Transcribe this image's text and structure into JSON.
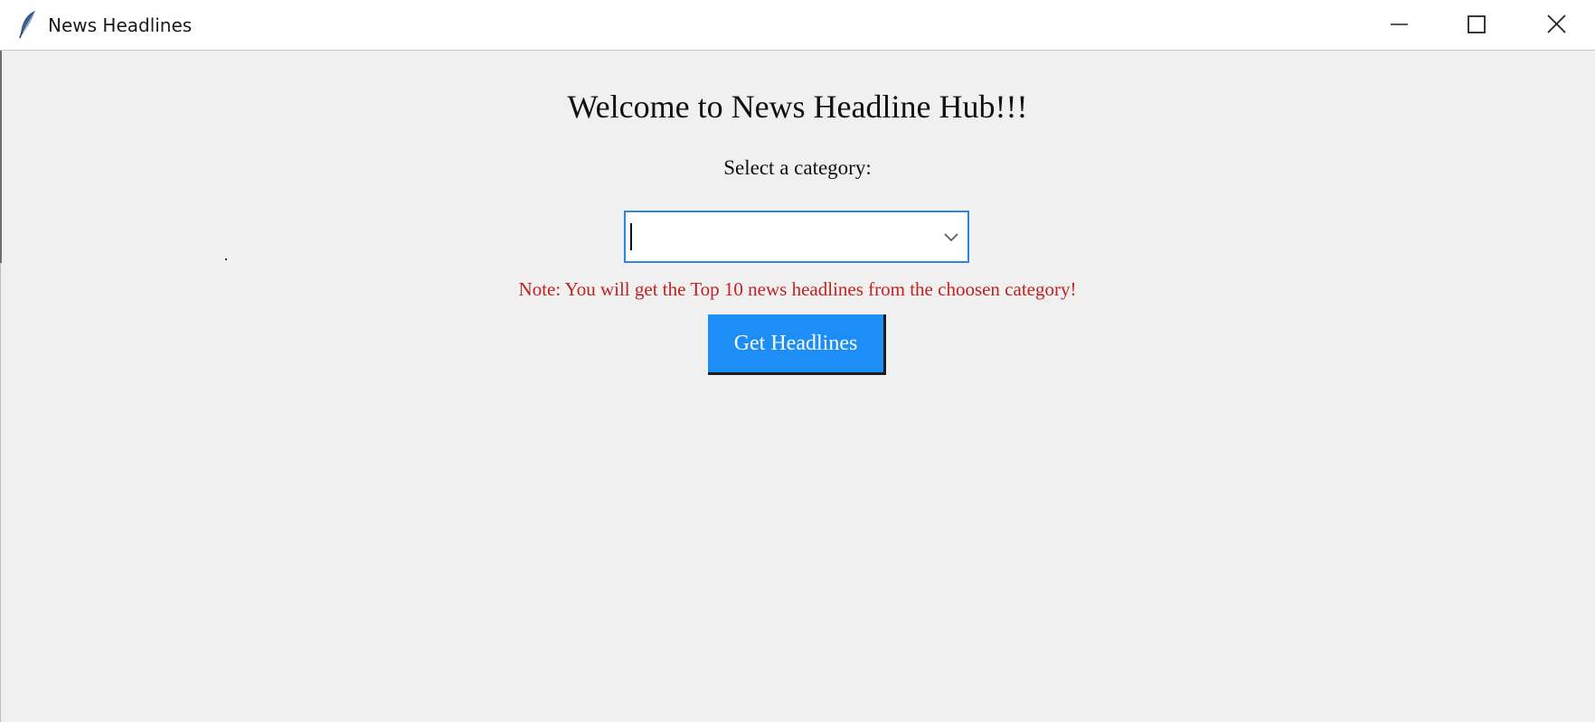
{
  "window": {
    "title": "News Headlines",
    "app_icon": "feather-icon",
    "controls": {
      "minimize_icon": "minimize-icon",
      "maximize_icon": "maximize-icon",
      "close_icon": "close-icon"
    }
  },
  "main": {
    "heading": "Welcome to News Headline Hub!!!",
    "category_label": "Select a category:",
    "category_combo": {
      "value": "",
      "dropdown_icon": "chevron-down-icon"
    },
    "note": "Note: You will get the Top 10 news headlines from the choosen category!",
    "get_button_label": "Get Headlines"
  },
  "colors": {
    "background": "#f0f0f0",
    "titlebar": "#ffffff",
    "combo_focus_border": "#2f87dc",
    "note_text": "#c42020",
    "button_bg": "#1e8ef7",
    "button_text": "#ffffff"
  }
}
